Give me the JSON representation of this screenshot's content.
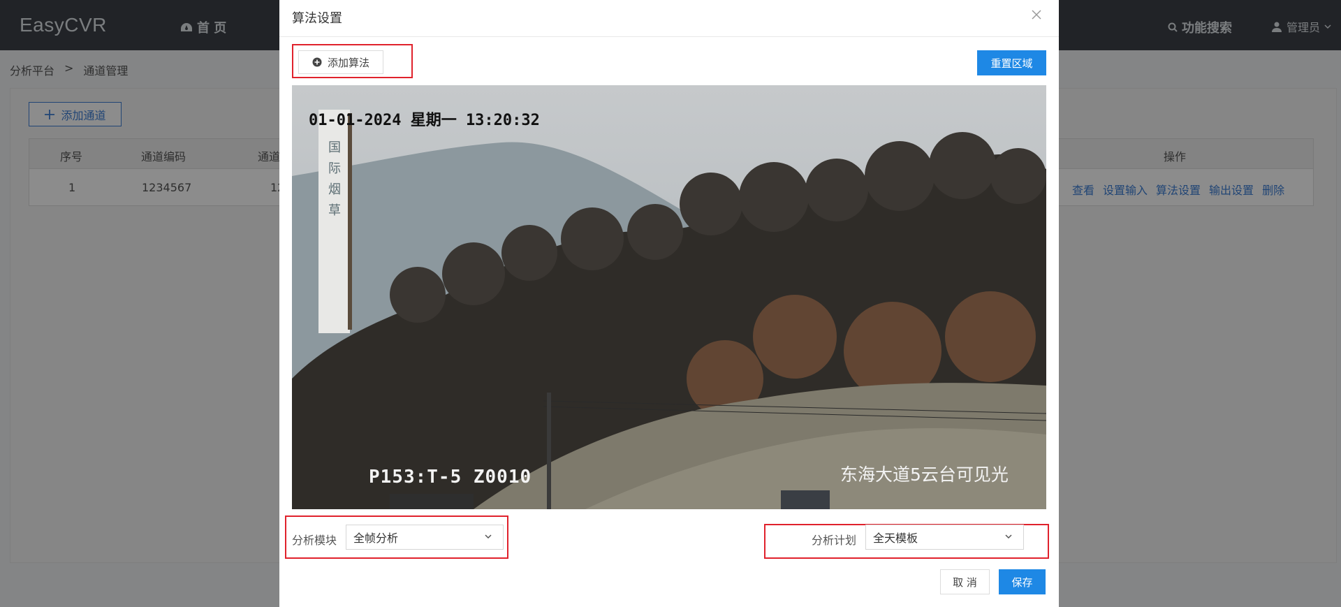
{
  "header": {
    "logo": "EasyCVR",
    "home": "首 页",
    "search": "功能搜索",
    "user": "管理员"
  },
  "breadcrumb": {
    "root": "分析平台",
    "sep": ">",
    "current": "通道管理"
  },
  "toolbar": {
    "add_channel": "添加通道"
  },
  "table": {
    "headers": [
      "序号",
      "通道编码",
      "通道",
      "操作"
    ],
    "rows": [
      {
        "index": "1",
        "code": "1234567",
        "partial": "12",
        "actions": [
          "查看",
          "设置输入",
          "算法设置",
          "输出设置",
          "删除"
        ]
      }
    ]
  },
  "modal": {
    "title": "算法设置",
    "add_algo": "添加算法",
    "reset_area": "重置区域",
    "video": {
      "timestamp": "01-01-2024 星期一 13:20:32",
      "code": "P153:T-5  Z0010",
      "place": "东海大道5云台可见光",
      "chimney_text": "国际烟草"
    },
    "analysis_module_label": "分析模块",
    "analysis_module_value": "全帧分析",
    "analysis_plan_label": "分析计划",
    "analysis_plan_value": "全天模板",
    "cancel": "取 消",
    "save": "保存"
  },
  "colors": {
    "primary": "#1e88e5",
    "link": "#3d7fd6",
    "highlight": "#e0222c",
    "header_bg": "#3c4048"
  }
}
